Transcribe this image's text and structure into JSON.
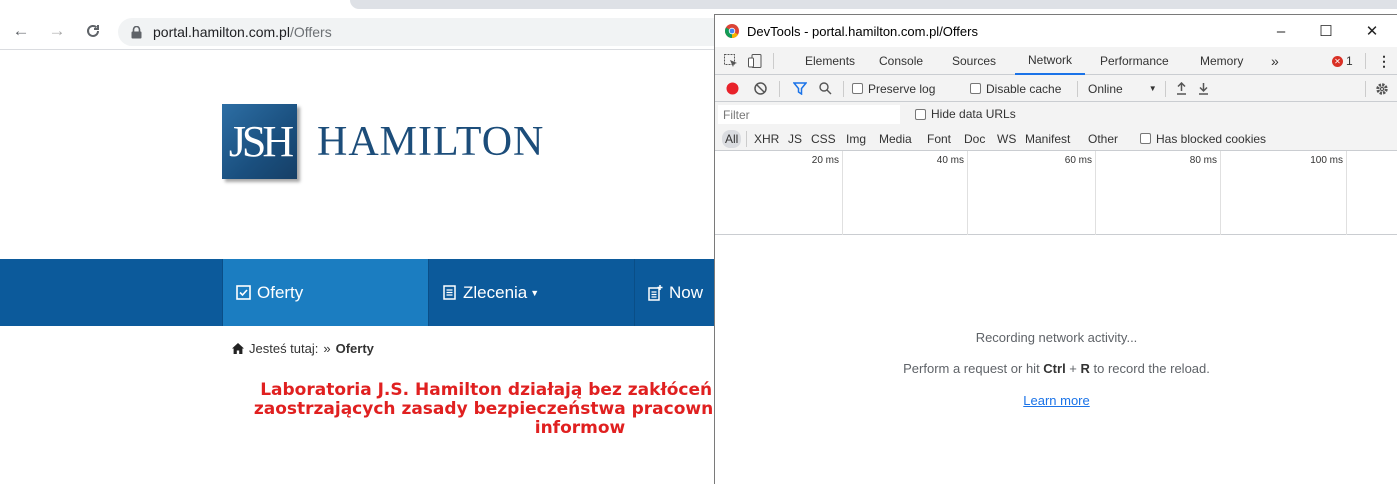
{
  "browser": {
    "url_host": "portal.hamilton.com.pl",
    "url_path": "/Offers"
  },
  "site": {
    "logo_mark": "JSH",
    "logo_text": "HAMILTON",
    "menu": [
      {
        "label": "Oferty",
        "icon": "checkbox-icon"
      },
      {
        "label": "Zlecenia",
        "icon": "document-icon"
      },
      {
        "label": "Now",
        "icon": "new-document-icon"
      }
    ],
    "breadcrumb": {
      "prefix": "Jesteś tutaj:",
      "separator": "»",
      "current": "Oferty"
    },
    "notice_lines": [
      "Laboratoria J.S. Hamilton działają bez zakłóceń i realizują wszelkie",
      "zaostrzających zasady bezpieczeństwa pracowników, także tych pra",
      "informow"
    ],
    "notice_color": "#e02020",
    "menu_color": "#0c5a9b",
    "menu_active_color": "#1b7dc1"
  },
  "devtools": {
    "title": "DevTools - portal.hamilton.com.pl/Offers",
    "window_controls": {
      "minimize": "–",
      "maximize": "☐",
      "close": "✕"
    },
    "tabs": [
      "Elements",
      "Console",
      "Sources",
      "Network",
      "Performance",
      "Memory"
    ],
    "active_tab": "Network",
    "more_tabs": "»",
    "error_count": "1",
    "toolbar": {
      "preserve_log": "Preserve log",
      "disable_cache": "Disable cache",
      "throttle": "Online"
    },
    "filter_placeholder": "Filter",
    "hide_data_urls": "Hide data URLs",
    "types": [
      "All",
      "XHR",
      "JS",
      "CSS",
      "Img",
      "Media",
      "Font",
      "Doc",
      "WS",
      "Manifest",
      "Other"
    ],
    "has_blocked_cookies": "Has blocked cookies",
    "timeline_ticks": [
      "20 ms",
      "40 ms",
      "60 ms",
      "80 ms",
      "100 ms"
    ],
    "empty": {
      "line1": "Recording network activity...",
      "line2_pre": "Perform a request or hit ",
      "key1": "Ctrl",
      "plus": " + ",
      "key2": "R",
      "line2_post": " to record the reload.",
      "link": "Learn more"
    },
    "accent": "#1a73e8",
    "record_color": "#e8222a"
  }
}
